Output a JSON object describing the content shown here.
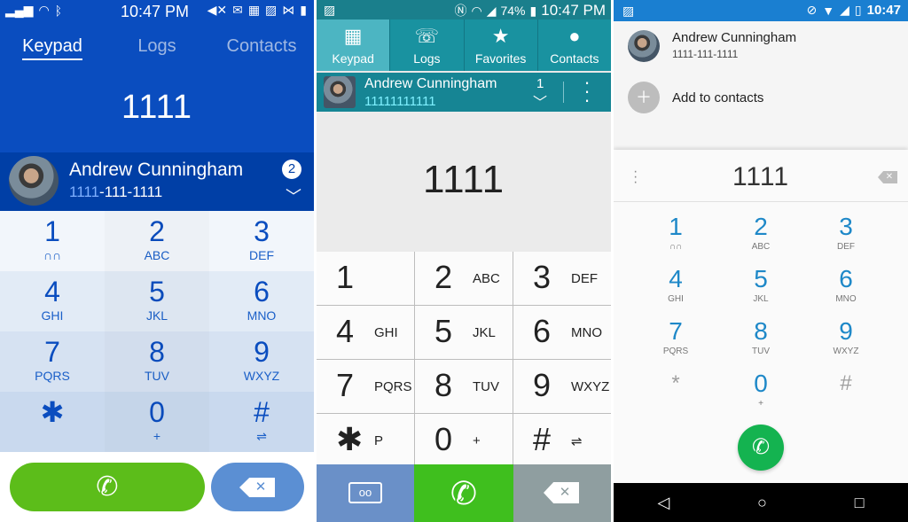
{
  "panel1": {
    "status": {
      "time": "10:47 PM"
    },
    "tabs": [
      "Keypad",
      "Logs",
      "Contacts"
    ],
    "number": "1111",
    "match": {
      "name": "Andrew Cunningham",
      "number_highlight": "1111",
      "number_rest": "-111-1111",
      "count": "2"
    },
    "keys": [
      {
        "digit": "1",
        "letters": "∩∩"
      },
      {
        "digit": "2",
        "letters": "ABC"
      },
      {
        "digit": "3",
        "letters": "DEF"
      },
      {
        "digit": "4",
        "letters": "GHI"
      },
      {
        "digit": "5",
        "letters": "JKL"
      },
      {
        "digit": "6",
        "letters": "MNO"
      },
      {
        "digit": "7",
        "letters": "PQRS"
      },
      {
        "digit": "8",
        "letters": "TUV"
      },
      {
        "digit": "9",
        "letters": "WXYZ"
      },
      {
        "digit": "✱",
        "letters": ""
      },
      {
        "digit": "0",
        "letters": "+"
      },
      {
        "digit": "#",
        "letters": "⇌"
      }
    ],
    "colors": {
      "header": "#0a4dbf",
      "call": "#5cbd1a",
      "delete": "#5b8fd3"
    }
  },
  "panel2": {
    "status": {
      "battery": "74%",
      "time": "10:47 PM"
    },
    "tabs": [
      {
        "icon": "keypad-icon",
        "label": "Keypad"
      },
      {
        "icon": "logs-icon",
        "label": "Logs"
      },
      {
        "icon": "star-icon",
        "label": "Favorites"
      },
      {
        "icon": "contacts-icon",
        "label": "Contacts"
      }
    ],
    "match": {
      "name": "Andrew Cunningham",
      "number": "11111111111",
      "count": "1"
    },
    "number": "1111",
    "keys": [
      {
        "digit": "1",
        "letters": ""
      },
      {
        "digit": "2",
        "letters": "ABC"
      },
      {
        "digit": "3",
        "letters": "DEF"
      },
      {
        "digit": "4",
        "letters": "GHI"
      },
      {
        "digit": "5",
        "letters": "JKL"
      },
      {
        "digit": "6",
        "letters": "MNO"
      },
      {
        "digit": "7",
        "letters": "PQRS"
      },
      {
        "digit": "8",
        "letters": "TUV"
      },
      {
        "digit": "9",
        "letters": "WXYZ"
      },
      {
        "digit": "✱",
        "letters": "P"
      },
      {
        "digit": "0",
        "letters": "+"
      },
      {
        "digit": "#",
        "letters": "⇌"
      }
    ],
    "colors": {
      "tabs": "#1992a0",
      "call": "#3fbf1e",
      "voicemail": "#6a90c8",
      "delete": "#8f9ea0"
    }
  },
  "panel3": {
    "status": {
      "time": "10:47"
    },
    "suggestion": {
      "name": "Andrew Cunningham",
      "number": "1111-111-1111"
    },
    "add_contact": "Add to contacts",
    "number": "1111",
    "keys": [
      {
        "digit": "1",
        "letters": "∩∩"
      },
      {
        "digit": "2",
        "letters": "ABC"
      },
      {
        "digit": "3",
        "letters": "DEF"
      },
      {
        "digit": "4",
        "letters": "GHI"
      },
      {
        "digit": "5",
        "letters": "JKL"
      },
      {
        "digit": "6",
        "letters": "MNO"
      },
      {
        "digit": "7",
        "letters": "PQRS"
      },
      {
        "digit": "8",
        "letters": "TUV"
      },
      {
        "digit": "9",
        "letters": "WXYZ"
      },
      {
        "digit": "*",
        "letters": ""
      },
      {
        "digit": "0",
        "letters": "+"
      },
      {
        "digit": "#",
        "letters": ""
      }
    ],
    "colors": {
      "status": "#1a7fd1",
      "digits": "#1e88c8",
      "call": "#14b350"
    }
  }
}
